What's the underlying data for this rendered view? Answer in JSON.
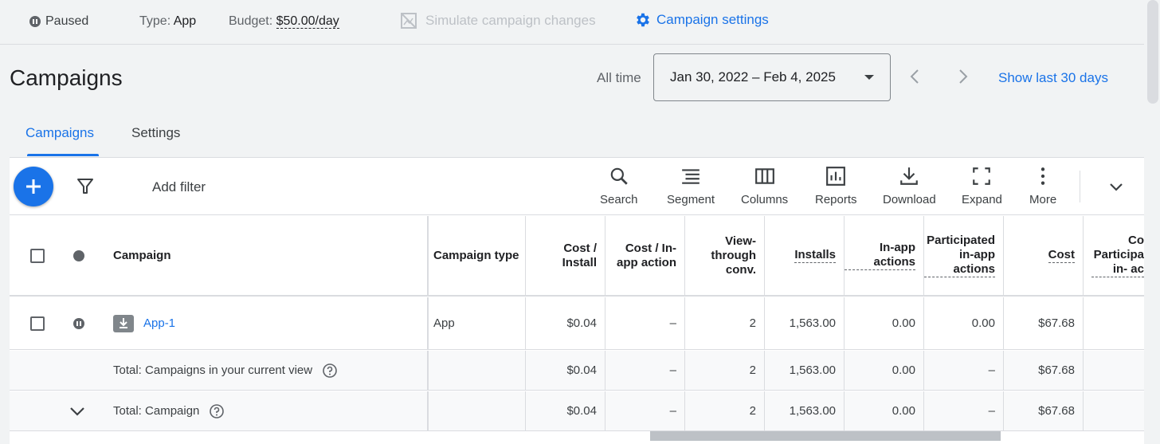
{
  "topbar": {
    "status": "Paused",
    "type_label": "Type:",
    "type_value": "App",
    "budget_label": "Budget:",
    "budget_value": "$50.00/day",
    "simulate": "Simulate campaign changes",
    "settings": "Campaign settings"
  },
  "header": {
    "title": "Campaigns",
    "range_label": "All time",
    "date_range": "Jan 30, 2022 – Feb 4, 2025",
    "show_last": "Show last 30 days"
  },
  "tabs": [
    {
      "label": "Campaigns",
      "active": true
    },
    {
      "label": "Settings",
      "active": false
    }
  ],
  "toolbar": {
    "add_filter": "Add filter",
    "tools": {
      "search": "Search",
      "segment": "Segment",
      "columns": "Columns",
      "reports": "Reports",
      "download": "Download",
      "expand": "Expand",
      "more": "More"
    }
  },
  "table": {
    "headers": {
      "campaign": "Campaign",
      "type": "Campaign type",
      "cost_install": "Cost / Install",
      "cost_inapp": "Cost / In-app action",
      "viewthrough": "View-through conv.",
      "installs": "Installs",
      "inapp_actions": "In-app actions",
      "participated": "Participated in-app actions",
      "cost": "Cost",
      "last_partial": "Co Participa in- ac"
    },
    "rows": [
      {
        "name": "App-1",
        "type": "App",
        "cost_install": "$0.04",
        "cost_inapp": "–",
        "viewthrough": "2",
        "installs": "1,563.00",
        "inapp_actions": "0.00",
        "participated": "0.00",
        "cost": "$67.68"
      }
    ],
    "totals": [
      {
        "label": "Total: Campaigns in your current view",
        "cost_install": "$0.04",
        "cost_inapp": "–",
        "viewthrough": "2",
        "installs": "1,563.00",
        "inapp_actions": "0.00",
        "participated": "–",
        "cost": "$67.68"
      },
      {
        "label": "Total: Campaign",
        "cost_install": "$0.04",
        "cost_inapp": "–",
        "viewthrough": "2",
        "installs": "1,563.00",
        "inapp_actions": "0.00",
        "participated": "–",
        "cost": "$67.68"
      }
    ]
  },
  "colors": {
    "accent": "#1a73e8",
    "status_paused": "#5f6368"
  }
}
